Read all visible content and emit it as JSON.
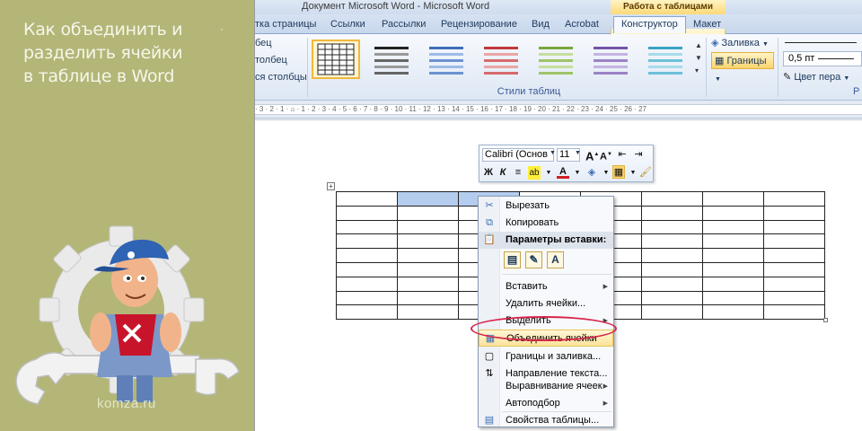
{
  "banner": {
    "title_lines": [
      "Как объединить и",
      "разделить ячейки",
      "в таблице в Word"
    ],
    "site": "komza.ru"
  },
  "window": {
    "title": "Документ Microsoft Word - Microsoft Word",
    "tool_group": "Работа с таблицами"
  },
  "tabs": [
    {
      "label": "тка страницы"
    },
    {
      "label": "Ссылки"
    },
    {
      "label": "Рассылки"
    },
    {
      "label": "Рецензирование"
    },
    {
      "label": "Вид"
    },
    {
      "label": "Acrobat"
    },
    {
      "label": "Конструктор",
      "active": true
    },
    {
      "label": "Макет"
    }
  ],
  "ribbon": {
    "left_options": [
      "бец",
      "толбец",
      "ся столбцы"
    ],
    "group_label": "Стили таблиц",
    "fill_label": "Заливка",
    "borders_label": "Границы",
    "pen_width": "0,5 пт",
    "pen_color_label": "Цвет пера",
    "right_cut": "Р"
  },
  "ruler": {
    "marks": "· 3 · 2 · 1 · ⌂ · 1 · 2 · 3 · 4 · 5 · 6 · 7 · 8 · 9 · 10 · 11 · 12 · 13 · 14 · 15 · 16 · 17 · 18 · 19 · 20 · 21 · 22 · 23 · 24 · 25 · 26 · 27"
  },
  "minibar": {
    "font": "Calibri (Основ",
    "size": "11",
    "bold": "Ж",
    "italic": "К"
  },
  "context_menu": {
    "items": [
      {
        "label": "Вырезать",
        "icon": "scissors-icon"
      },
      {
        "label": "Копировать",
        "icon": "copy-icon"
      },
      {
        "label": "Параметры вставки:",
        "icon": "paste-icon"
      },
      {
        "label": "Вставить",
        "submenu": true
      },
      {
        "label": "Удалить ячейки..."
      },
      {
        "label": "Выделить",
        "submenu": true
      },
      {
        "label": "Объединить ячейки",
        "icon": "merge-cells-icon",
        "highlighted": true
      },
      {
        "label": "Границы и заливка...",
        "icon": "borders-icon"
      },
      {
        "label": "Направление текста...",
        "icon": "text-direction-icon"
      },
      {
        "label": "Выравнивание ячеек",
        "submenu": true
      },
      {
        "label": "Автоподбор",
        "submenu": true
      },
      {
        "label": "Свойства таблицы...",
        "icon": "table-properties-icon"
      }
    ],
    "paste_text_option": "A"
  },
  "table": {
    "rows": 9,
    "cols": 8,
    "selected_row": 0,
    "selected_cols": [
      1,
      2
    ]
  },
  "colors": {
    "banner_bg": "#b3b677",
    "highlight_oval": "#d6244b",
    "selection": "#b4cdef"
  }
}
